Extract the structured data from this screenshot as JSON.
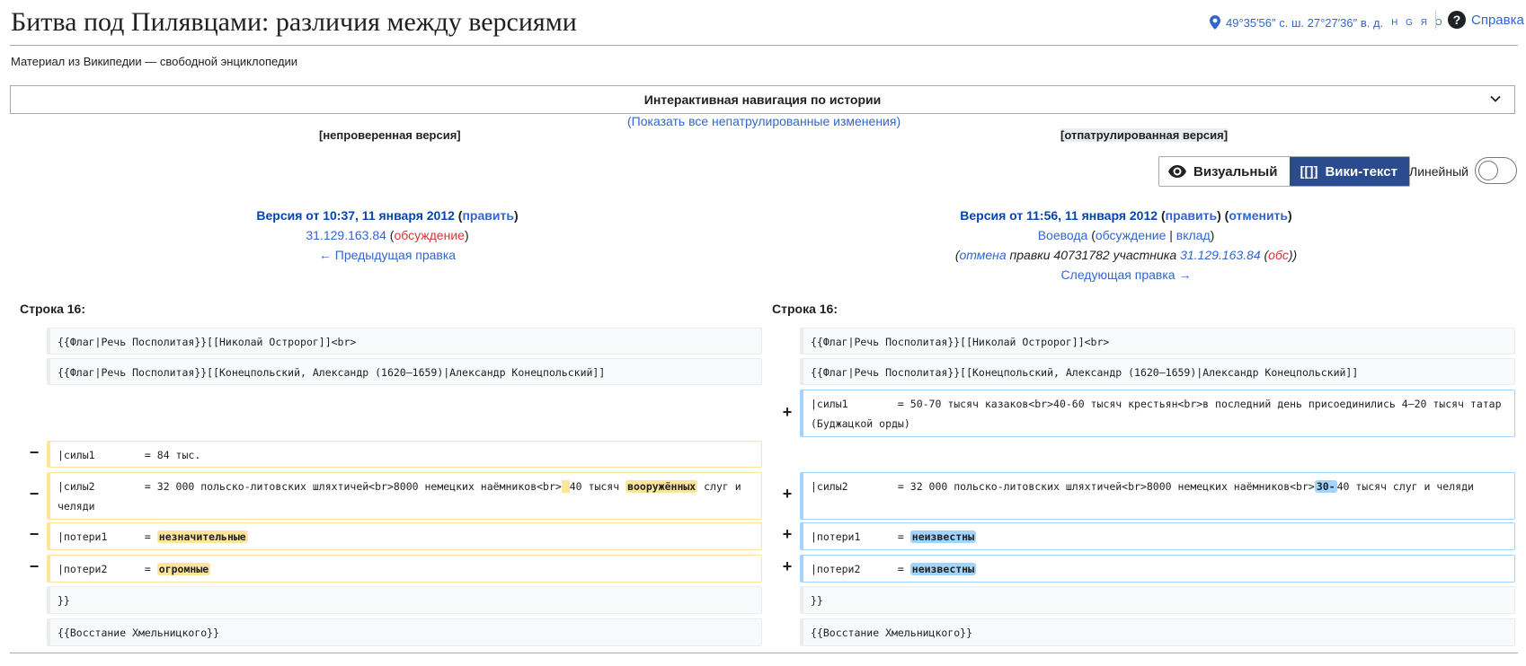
{
  "page": {
    "title": "Битва под Пилявцами: различия между версиями",
    "tagline": "Материал из Википедии — свободной энциклопедии"
  },
  "indicators": {
    "coords": "49°35′56″ с. ш. 27°27′36″ в. д.",
    "coords_links": "H G Я O",
    "help": "Справка"
  },
  "history_nav": {
    "title": "Интерактивная навигация по истории",
    "show_all": "(Показать все непатрулированные изменения)"
  },
  "versions": {
    "left_tag": "[непроверенная версия]",
    "right_tag": "[отпатрулированная версия]"
  },
  "view_toggle": {
    "visual": "Визуальный",
    "wikitext_icon": "[[]]",
    "wikitext": "Вики-текст",
    "linear": "Линейный"
  },
  "left_meta": {
    "title": "Версия от 10:37, 11 января 2012",
    "edit_open": " (",
    "edit": "править",
    "edit_close": ")",
    "user": "31.129.163.84",
    "talk_open": " (",
    "talk": "обсуждение",
    "talk_close": ")",
    "prev": "← Предыдущая правка"
  },
  "right_meta": {
    "title": "Версия от 11:56, 11 января 2012",
    "edit": "править",
    "undo": "отменить",
    "user": "Воевода",
    "talk": "обсуждение",
    "sep": " | ",
    "contrib": "вклад",
    "summary_undo": "отмена",
    "summary_mid": " правки 40731782 участника ",
    "summary_user": "31.129.163.84",
    "summary_talk": "обс",
    "next": "Следующая правка →"
  },
  "diff": {
    "line_left": "Строка 16:",
    "line_right": "Строка 16:",
    "ctx1": "{{Флаг|Речь Посполитая}}[[Николай Остророг]]<br>",
    "ctx2": "{{Флаг|Речь Посполитая}}[[Конецпольский, Александр (1620—1659)|Александр Конецпольский]]",
    "add_sily1": "|силы1        = 50-70 тысяч казаков<br>40-60 тысяч крестьян<br>в последний день присоединились 4—20 тысяч татар (Буджацкой орды)",
    "del_sily1": "|силы1        = 84 тыс.",
    "del_sily2_a": "|силы2        = 32 000 польско-литовских шляхтичей<br>8000 немецких наёмников<br>",
    "del_sily2_hl1": " ",
    "del_sily2_b": "40 тысяч ",
    "del_sily2_hl2": "вооружённых",
    "del_sily2_c": " слуг и челяди",
    "add_sily2_a": "|силы2        = 32 000 польско-литовских шляхтичей<br>8000 немецких наёмников<br>",
    "add_sily2_hl": "30-",
    "add_sily2_b": "40 тысяч слуг и челяди",
    "del_poteri1_a": "|потери1      = ",
    "del_poteri1_hl": "незначительные",
    "del_poteri2_a": "|потери2      = ",
    "del_poteri2_hl": "огромные",
    "add_poteri1_a": "|потери1      = ",
    "add_poteri1_hl": "неизвестны",
    "add_poteri2_a": "|потери2      = ",
    "add_poteri2_hl": "неизвестны",
    "ctx3": "}}",
    "ctx4": "{{Восстание Хмельницкого}}",
    "minus": "−",
    "plus": "+"
  }
}
